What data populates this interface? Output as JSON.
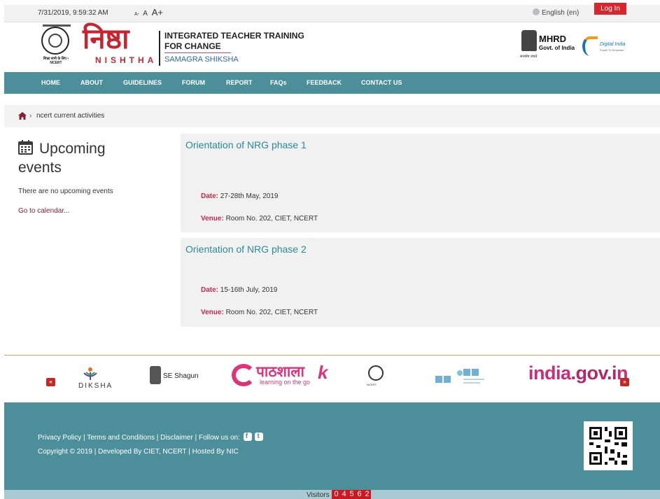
{
  "topbar": {
    "datetime": "7/31/2019, 9:59:32 AM",
    "font_small": "A-",
    "font_normal": "A",
    "font_large": "A+",
    "language": "English (en)",
    "login": "Log In"
  },
  "header": {
    "emblem_text": "शिक्षा सभी के लिए • NCERT",
    "logo_hindi": "निष्ठा",
    "logo_english": "NISHTHA",
    "title_line1": "INTEGRATED TEACHER TRAINING",
    "title_line2": "FOR CHANGE",
    "subtitle": "SAMAGRA SHIKSHA",
    "mhrd_line1": "MHRD",
    "mhrd_line2": "Govt. of India",
    "mhrd_sub": "सत्यमेव जयते",
    "digital_india": "Digital India",
    "digital_india_sub": "Power To Empower"
  },
  "nav": {
    "items": [
      {
        "label": "HOME"
      },
      {
        "label": "ABOUT"
      },
      {
        "label": "GUIDELINES"
      },
      {
        "label": "FORUM"
      },
      {
        "label": "REPORT"
      },
      {
        "label": "FAQs"
      },
      {
        "label": "FEEDBACK"
      },
      {
        "label": "CONTACT US"
      }
    ]
  },
  "breadcrumb": {
    "separator": "›",
    "current": "ncert current activities"
  },
  "sidebar": {
    "title_line1": "Upcoming",
    "title_line2": "events",
    "empty_message": "There are no upcoming events",
    "calendar_link": "Go to calendar..."
  },
  "events": [
    {
      "title": "Orientation of NRG phase 1",
      "date_label": "Date:",
      "date": "27-28th May, 2019",
      "venue_label": "Venue:",
      "venue": "Room No. 202, CIET, NCERT"
    },
    {
      "title": "Orientation of NRG phase 2",
      "date_label": "Date:",
      "date": "15-16th July, 2019",
      "venue_label": "Venue:",
      "venue": "Room No. 202, CIET, NCERT"
    }
  ],
  "partners": {
    "prev": "«",
    "next": "»",
    "diksha": "DIKSHA",
    "shagun": "SE Shagun",
    "epathshala": "पाठशाला",
    "epathshala_tagline": "learning on the go",
    "ncert_sub": "NCERT",
    "nroer": "NROER",
    "india_gov_1": "india",
    "india_gov_2": ".gov.i",
    "india_gov_3": "n"
  },
  "footer": {
    "privacy": "Privacy Policy",
    "terms": "Terms and Conditions",
    "disclaimer": "Disclaimer",
    "follow": "Follow us on:",
    "sep": "|",
    "copyright": "Copyright © 2019 | Developed By CIET, NCERT | Hosted By NIC",
    "visitors_label": "Visitors",
    "visitor_digits": [
      "0",
      "4",
      "5",
      "6",
      "2"
    ]
  },
  "colors": {
    "nav_bg": "#4c8f9b",
    "accent_red": "#d9262e",
    "link_teal": "#2b8a99",
    "label_crimson": "#c02a4e"
  }
}
